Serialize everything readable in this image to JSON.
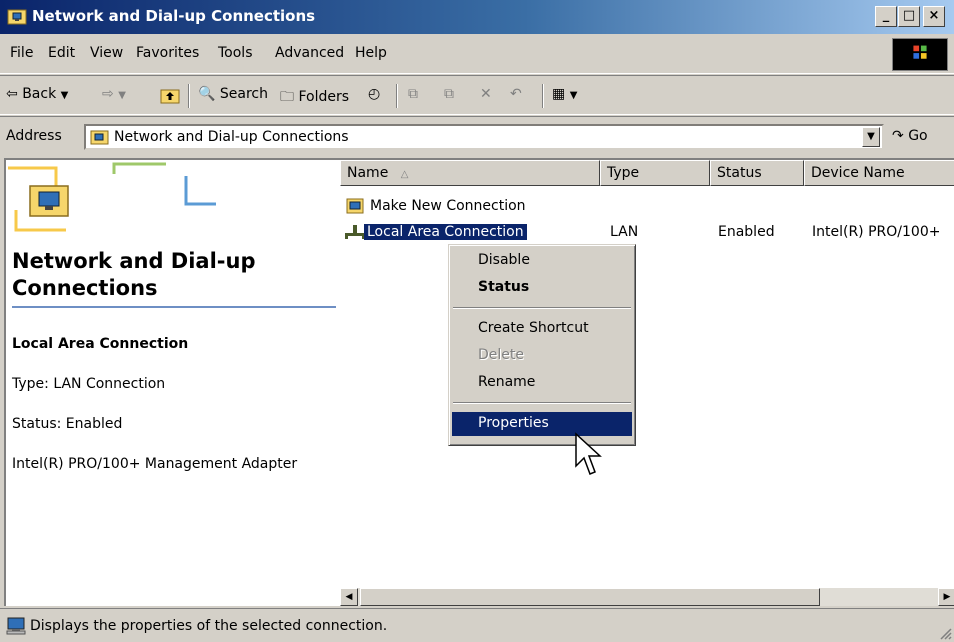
{
  "window": {
    "title": "Network and Dial-up Connections",
    "minimize": "_",
    "maximize": "□",
    "close": "×"
  },
  "menu": {
    "items": [
      "File",
      "Edit",
      "View",
      "Favorites",
      "Tools",
      "Advanced",
      "Help"
    ]
  },
  "toolbar": {
    "back_label": "Back",
    "search_label": "Search",
    "folders_label": "Folders"
  },
  "address": {
    "label": "Address",
    "value": "Network and Dial-up Connections",
    "go_label": "Go"
  },
  "left_pane": {
    "title": "Network and Dial-up Connections",
    "selected_name": "Local Area Connection",
    "type_text": "Type: LAN Connection",
    "status_text": "Status: Enabled",
    "device_text": "Intel(R) PRO/100+ Management Adapter"
  },
  "list": {
    "columns": [
      "Name",
      "Type",
      "Status",
      "Device Name"
    ],
    "rows": [
      {
        "name": "Make New Connection",
        "type": "",
        "status": "",
        "device": ""
      },
      {
        "name": "Local Area Connection",
        "type": "LAN",
        "status": "Enabled",
        "device": "Intel(R) PRO/100+"
      }
    ]
  },
  "context_menu": {
    "items": [
      "Disable",
      "Status",
      "Create Shortcut",
      "Delete",
      "Rename",
      "Properties"
    ]
  },
  "status_bar": {
    "text": "Displays the properties of the selected connection."
  },
  "colors": {
    "title_active": "#0a246a",
    "selection": "#0a246a",
    "face": "#d4d0c8"
  },
  "icons": [
    "network-folder-icon",
    "back-arrow-icon",
    "forward-arrow-icon",
    "up-folder-icon",
    "search-icon",
    "folders-icon",
    "history-icon",
    "move-to-icon",
    "copy-to-icon",
    "delete-icon",
    "undo-icon",
    "views-icon",
    "go-arrow-icon",
    "make-new-connection-icon",
    "lan-connection-icon",
    "sort-ascending-icon",
    "windows-logo-icon",
    "mouse-cursor-icon",
    "computer-icon"
  ]
}
